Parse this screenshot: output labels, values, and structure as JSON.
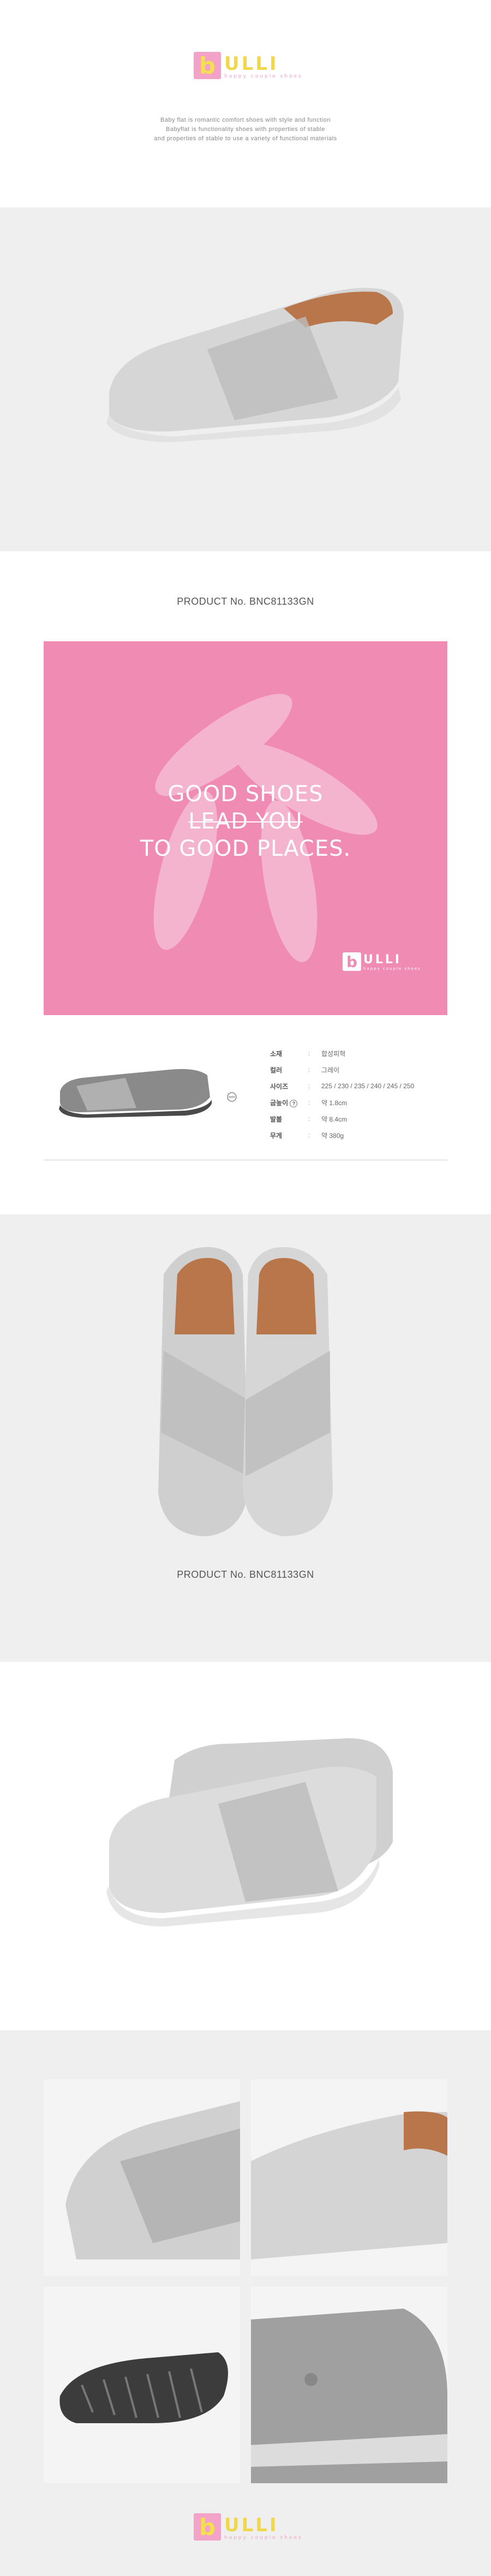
{
  "brand": {
    "logo_letter": "b",
    "logo_text": "ULLI",
    "tagline": "happy couple shoes"
  },
  "intro_lines": [
    "Baby flat is romantic comfort shoes with style and function",
    "Babyflat is functionality shoes with properties of stable",
    "and properties of stable to use a variety of functional materials"
  ],
  "product_no": "PRODUCT No. BNC81133GN",
  "slogan_lines": [
    "GOOD SHOES",
    "LEAD YOU",
    "TO GOOD PLACES."
  ],
  "specs": [
    {
      "label": "소재",
      "value": "합성피혁"
    },
    {
      "label": "컬러",
      "value": "그레이"
    },
    {
      "label": "사이즈",
      "value": "225 / 230 / 235 / 240 / 245 / 250"
    },
    {
      "label": "굽높이",
      "value": "약 1.8cm"
    },
    {
      "label": "발볼",
      "value": "약 8.4cm"
    },
    {
      "label": "무게",
      "value": "약 380g"
    }
  ],
  "colors": {
    "pink": "#f08cb4",
    "yellow": "#f4e04a",
    "band": "#efefef",
    "shoe": "#cfcfcf"
  }
}
